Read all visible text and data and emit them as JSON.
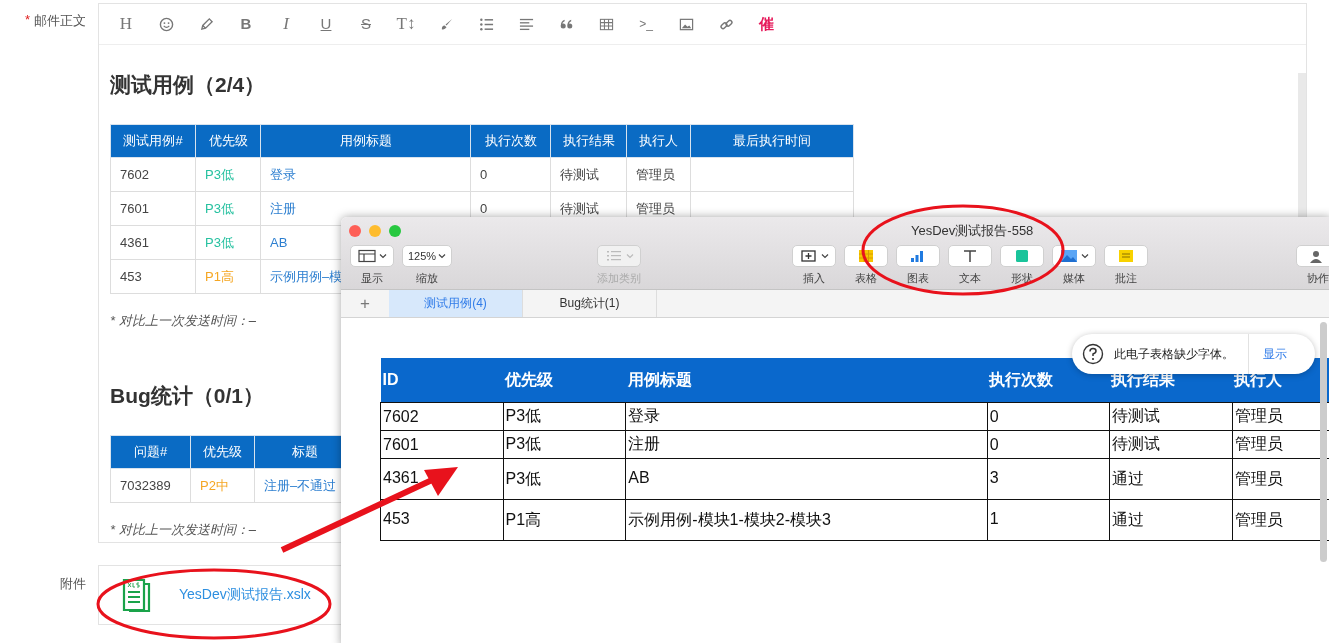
{
  "form": {
    "required_mark": "*",
    "body_label": "邮件正文",
    "attachment_label": "附件"
  },
  "editor": {
    "toolbar": [
      {
        "kind": "heading",
        "label": "H"
      },
      {
        "kind": "smiley"
      },
      {
        "kind": "pencil"
      },
      {
        "kind": "bold",
        "label": "B"
      },
      {
        "kind": "italic",
        "label": "I"
      },
      {
        "kind": "underline",
        "label": "U"
      },
      {
        "kind": "strike",
        "label": "S"
      },
      {
        "kind": "font-size",
        "label": "T↕"
      },
      {
        "kind": "brush"
      },
      {
        "kind": "bullets"
      },
      {
        "kind": "align"
      },
      {
        "kind": "quote"
      },
      {
        "kind": "table"
      },
      {
        "kind": "code",
        "label": ">_"
      },
      {
        "kind": "image"
      },
      {
        "kind": "link"
      },
      {
        "kind": "urge",
        "label": "催"
      }
    ],
    "sections": [
      {
        "heading": "测试用例（2/4）",
        "columns": [
          "测试用例#",
          "优先级",
          "用例标题",
          "执行次数",
          "执行结果",
          "执行人",
          "最后执行时间"
        ],
        "rows": [
          {
            "cells": [
              "7602",
              "P3低",
              "登录",
              "0",
              "待测试",
              "管理员"
            ],
            "color": "#26c1a0"
          },
          {
            "cells": [
              "7601",
              "P3低",
              "注册",
              "0",
              "待测试",
              "管理员"
            ],
            "color": "#26c1a0"
          },
          {
            "cells": [
              "4361",
              "P3低",
              "AB"
            ],
            "color": "#26c1a0"
          },
          {
            "cells": [
              "453",
              "P1高",
              "示例用例–模"
            ],
            "color": "#f5a623"
          }
        ],
        "note": "* 对比上一次发送时间：–"
      },
      {
        "heading": "Bug统计（0/1）",
        "columns": [
          "问题#",
          "优先级",
          "标题"
        ],
        "rows": [
          {
            "cells": [
              "7032389",
              "P2中",
              "注册–不通过"
            ],
            "color": "#f5a623"
          }
        ],
        "note": "* 对比上一次发送时间：–"
      }
    ]
  },
  "attachment": {
    "file_name": "YesDev测试报告.xslx"
  },
  "numbers_window": {
    "title": "YesDev测试报告-558",
    "toolbar": [
      {
        "kind": "sidebar",
        "label": "显示",
        "disabled": false
      },
      {
        "kind": "zoom",
        "value": "125%",
        "label": "缩放",
        "disabled": false
      },
      {
        "kind": "category",
        "label": "添加类别",
        "disabled": true
      },
      {
        "kind": "insert",
        "label": "插入",
        "disabled": false
      },
      {
        "kind": "table",
        "label": "表格",
        "disabled": false
      },
      {
        "kind": "chart",
        "label": "图表",
        "disabled": false
      },
      {
        "kind": "text",
        "label": "文本",
        "disabled": false
      },
      {
        "kind": "shape",
        "label": "形状",
        "disabled": false
      },
      {
        "kind": "media",
        "label": "媒体",
        "disabled": false
      },
      {
        "kind": "comment",
        "label": "批注",
        "disabled": false
      },
      {
        "kind": "collaborate",
        "label": "协作",
        "disabled": false
      }
    ],
    "add_sheet": "+",
    "sheet_tabs": [
      {
        "label": "测试用例(4)",
        "selected": true
      },
      {
        "label": "Bug统计(1)",
        "selected": false
      }
    ],
    "table": {
      "columns": [
        "ID",
        "优先级",
        "用例标题",
        "执行次数",
        "执行结果",
        "执行人"
      ],
      "rows": [
        {
          "cells": [
            "7602",
            "P3低",
            "登录",
            "0",
            "待测试",
            "管理员"
          ]
        },
        {
          "cells": [
            "7601",
            "P3低",
            "注册",
            "0",
            "待测试",
            "管理员"
          ]
        },
        {
          "cells": [
            "4361",
            "P3低",
            "AB",
            "3",
            "通过",
            "管理员"
          ]
        },
        {
          "cells": [
            "453",
            "P1高",
            "示例用例-模块1-模块2-模块3",
            "1",
            "通过",
            "管理员"
          ]
        }
      ]
    },
    "notice": {
      "message": "此电子表格缺少字体。",
      "action": "显示"
    }
  }
}
